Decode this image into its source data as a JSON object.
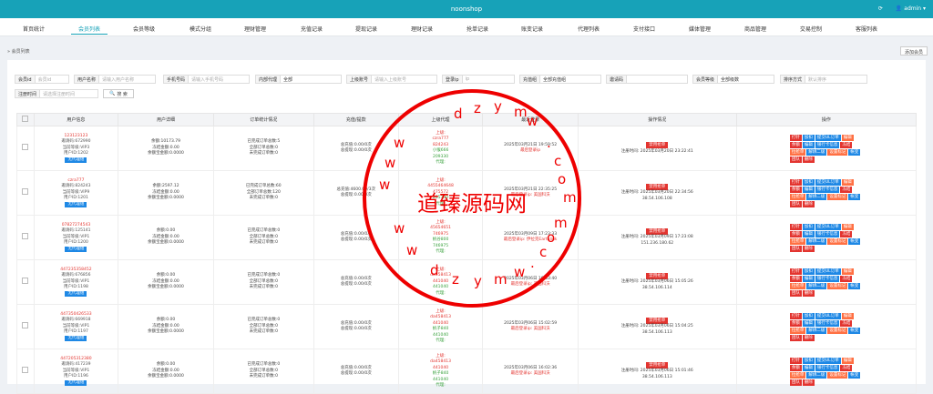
{
  "app": {
    "title": "noonshop",
    "admin": "admin"
  },
  "tabs": [
    "首页统计",
    "会员列表",
    "会员等级",
    "模式分组",
    "理财管理",
    "充值记录",
    "提现记录",
    "理财记录",
    "抢单记录",
    "账变记录",
    "代理列表",
    "支付接口",
    "媒体管理",
    "商品管理",
    "交易控制",
    "客服列表"
  ],
  "crumb": "会员列表",
  "add_label": "添加会员",
  "filters": [
    {
      "label": "会员id",
      "ph": "会员id"
    },
    {
      "label": "用户名称",
      "ph": "请输入用户名称"
    },
    {
      "label": "手机号码",
      "ph": "请输入手机号码"
    },
    {
      "label": "内部代理",
      "value": "全部"
    },
    {
      "label": "上级账号",
      "ph": "请输入上级账号"
    },
    {
      "label": "登录ip",
      "ph": "ip"
    },
    {
      "label": "充值组",
      "value": "全部充值组"
    },
    {
      "label": "邀请码",
      "ph": ""
    },
    {
      "label": "会员等级",
      "value": "全部级数"
    },
    {
      "label": "排序方式",
      "ph": "默认排序"
    },
    {
      "label": "注册时间",
      "ph": "请选择注册时间"
    }
  ],
  "search_label": "搜 索",
  "columns": [
    "用户信息",
    "用户详细",
    "订单统计情况",
    "充值/提款",
    "上级代理",
    "最近登录",
    "操作情况",
    "操作"
  ],
  "rows": [
    {
      "id": "123123123",
      "l1": "邀请码:672990",
      "l2": "当前等级:VIP3",
      "l3": "用户ID:1202",
      "badge": "无代理组",
      "a": "余额:10173.79",
      "b": "冻结金额:0.00",
      "c": "余额宝金额:0.0000",
      "o1": "已完成订单总数:5",
      "o2": "全部订单总数:0",
      "o3": "未完成订单数:0",
      "r1": "总充值:0.00/0次",
      "r2": "总提现:0.00/0次",
      "p": [
        "czra777",
        "824243",
        "小猴666",
        "209330"
      ],
      "login": "2025年03月21日 19:59:52",
      "loginip": "最后登录ip",
      "status": "禁用抢单",
      "reg": "注册时间: 2025年03月20日 23:22:41"
    },
    {
      "id": "czra777",
      "l1": "邀请码:824243",
      "l2": "当前等级:VIP9",
      "l3": "用户ID:1201",
      "badge": "无代理组",
      "a": "余额:2597.12",
      "b": "冻结金额:0.00",
      "c": "余额宝金额:0.0000",
      "o1": "已完成订单总数:60",
      "o2": "全部订单总数:120",
      "o3": "未完成订单数:0",
      "r1": "总充值:4600.00/3次",
      "r2": "总提现:0.00/0次",
      "p": [
        "4455464648",
        "475572",
        "",
        "205330"
      ],
      "login": "2025年03月21日 22:35:25",
      "loginip": "最后登录ip: 美国科沃",
      "status": "禁用抢单",
      "reg": "注册时间: 2025年03月20日 22:34:56",
      "regip": "38.54.106.108"
    },
    {
      "id": "07827274543",
      "l1": "邀请码:125141",
      "l2": "当前等级:VIP1",
      "l3": "用户ID:1200",
      "badge": "无代理组",
      "a": "余额:0.00",
      "b": "冻结金额:0.00",
      "c": "余额宝金额:0.0000",
      "o1": "已完成订单总数:0",
      "o2": "全部订单总数:0",
      "o3": "未完成订单数:0",
      "r1": "总充值:0.00/0次",
      "r2": "总提现:0.00/0次",
      "p": [
        "45654651",
        "746975",
        "帆谷800",
        "746975"
      ],
      "login": "2025年03月09日 17:23:33",
      "loginip": "最后登录ip: 伊拉克Earthlink",
      "status": "禁用抢单",
      "reg": "注册时间: 2025年03月09日 17:23:08",
      "regip": "151.236.180.62"
    },
    {
      "id": "447235358452",
      "l1": "邀请码:676856",
      "l2": "当前等级:VIP1",
      "l3": "用户ID:1198",
      "badge": "无代理组",
      "a": "余额:0.00",
      "b": "冻结金额:0.00",
      "c": "余额宝金额:0.0000",
      "o1": "已完成订单总数:0",
      "o2": "全部订单总数:0",
      "o3": "未完成订单数:0",
      "r1": "总充值:0.00/0次",
      "r2": "总提现:0.00/0次",
      "p": [
        "da458413",
        "441040",
        "",
        "441040"
      ],
      "login": "2025年03月06日 16:03:40",
      "loginip": "最后登录ip: 美国科沃",
      "status": "禁用抢单",
      "reg": "注册时间: 2025年03月06日 15:05:26",
      "regip": "38.54.106.114"
    },
    {
      "id": "447350426533",
      "l1": "邀请码:669918",
      "l2": "当前等级:VIP1",
      "l3": "用户ID:1197",
      "badge": "无代理组",
      "a": "余额:0.00",
      "b": "冻结金额:0.00",
      "c": "余额宝金额:0.0000",
      "o1": "已完成订单总数:0",
      "o2": "全部订单总数:0",
      "o3": "未完成订单数:0",
      "r1": "总充值:0.00/0次",
      "r2": "总提现:0.00/0次",
      "p": [
        "da458413",
        "441040",
        "帆子840",
        "441040"
      ],
      "login": "2025年03月06日 15:02:59",
      "loginip": "最后登录ip: 美国科沃",
      "status": "禁用抢单",
      "reg": "注册时间: 2025年03月06日 15:04:25",
      "regip": "38.54.106.113"
    },
    {
      "id": "447205312380",
      "l1": "邀请码:417239",
      "l2": "当前等级:VIP1",
      "l3": "用户ID:1196",
      "badge": "无代理组",
      "a": "余额:0.00",
      "b": "冻结金额:0.00",
      "c": "余额宝金额:0.0000",
      "o1": "已完成订单总数:0",
      "o2": "全部订单总数:0",
      "o3": "未完成订单数:0",
      "r1": "总充值:0.00/0次",
      "r2": "总提现:0.00/0次",
      "p": [
        "da458413",
        "441040",
        "帆子840",
        "441040"
      ],
      "login": "2025年03月06日 16:02:36",
      "loginip": "最后登录ip: 美国科沃",
      "status": "禁用抢单",
      "reg": "注册时间: 2025年03月06日 15:01:46",
      "regip": "38.54.106.113"
    }
  ],
  "ops": [
    {
      "t": "打针",
      "c": "#e3342f"
    },
    {
      "t": "加扣",
      "c": "#1e88e5"
    },
    {
      "t": "提交UL订单",
      "c": "#1e88e5"
    },
    {
      "t": "编辑",
      "c": "#ff7043"
    },
    {
      "t": "余额",
      "c": "#e3342f"
    },
    {
      "t": "编辑",
      "c": "#1e88e5"
    },
    {
      "t": "银行卡信息",
      "c": "#1e88e5"
    },
    {
      "t": "冻结",
      "c": "#e3342f"
    },
    {
      "t": "拉抢单",
      "c": "#ff7043"
    },
    {
      "t": "解绑二级",
      "c": "#1e88e5"
    },
    {
      "t": "设置标记",
      "c": "#ff7043"
    },
    {
      "t": "帐变",
      "c": "#1e88e5"
    },
    {
      "t": "团队",
      "c": "#e3342f"
    },
    {
      "t": "删除",
      "c": "#e3342f"
    }
  ],
  "upper_label": "上级:",
  "agent_label": "代理:",
  "watermark": {
    "center": "道臻源码网",
    "chars": [
      "d",
      "z",
      "y",
      "m",
      "w",
      ".",
      "c",
      "o",
      "m",
      "w",
      "w",
      "w",
      "w",
      "w",
      "d",
      "z",
      "y",
      "m",
      "w",
      ".",
      "c",
      "o",
      "m"
    ]
  }
}
